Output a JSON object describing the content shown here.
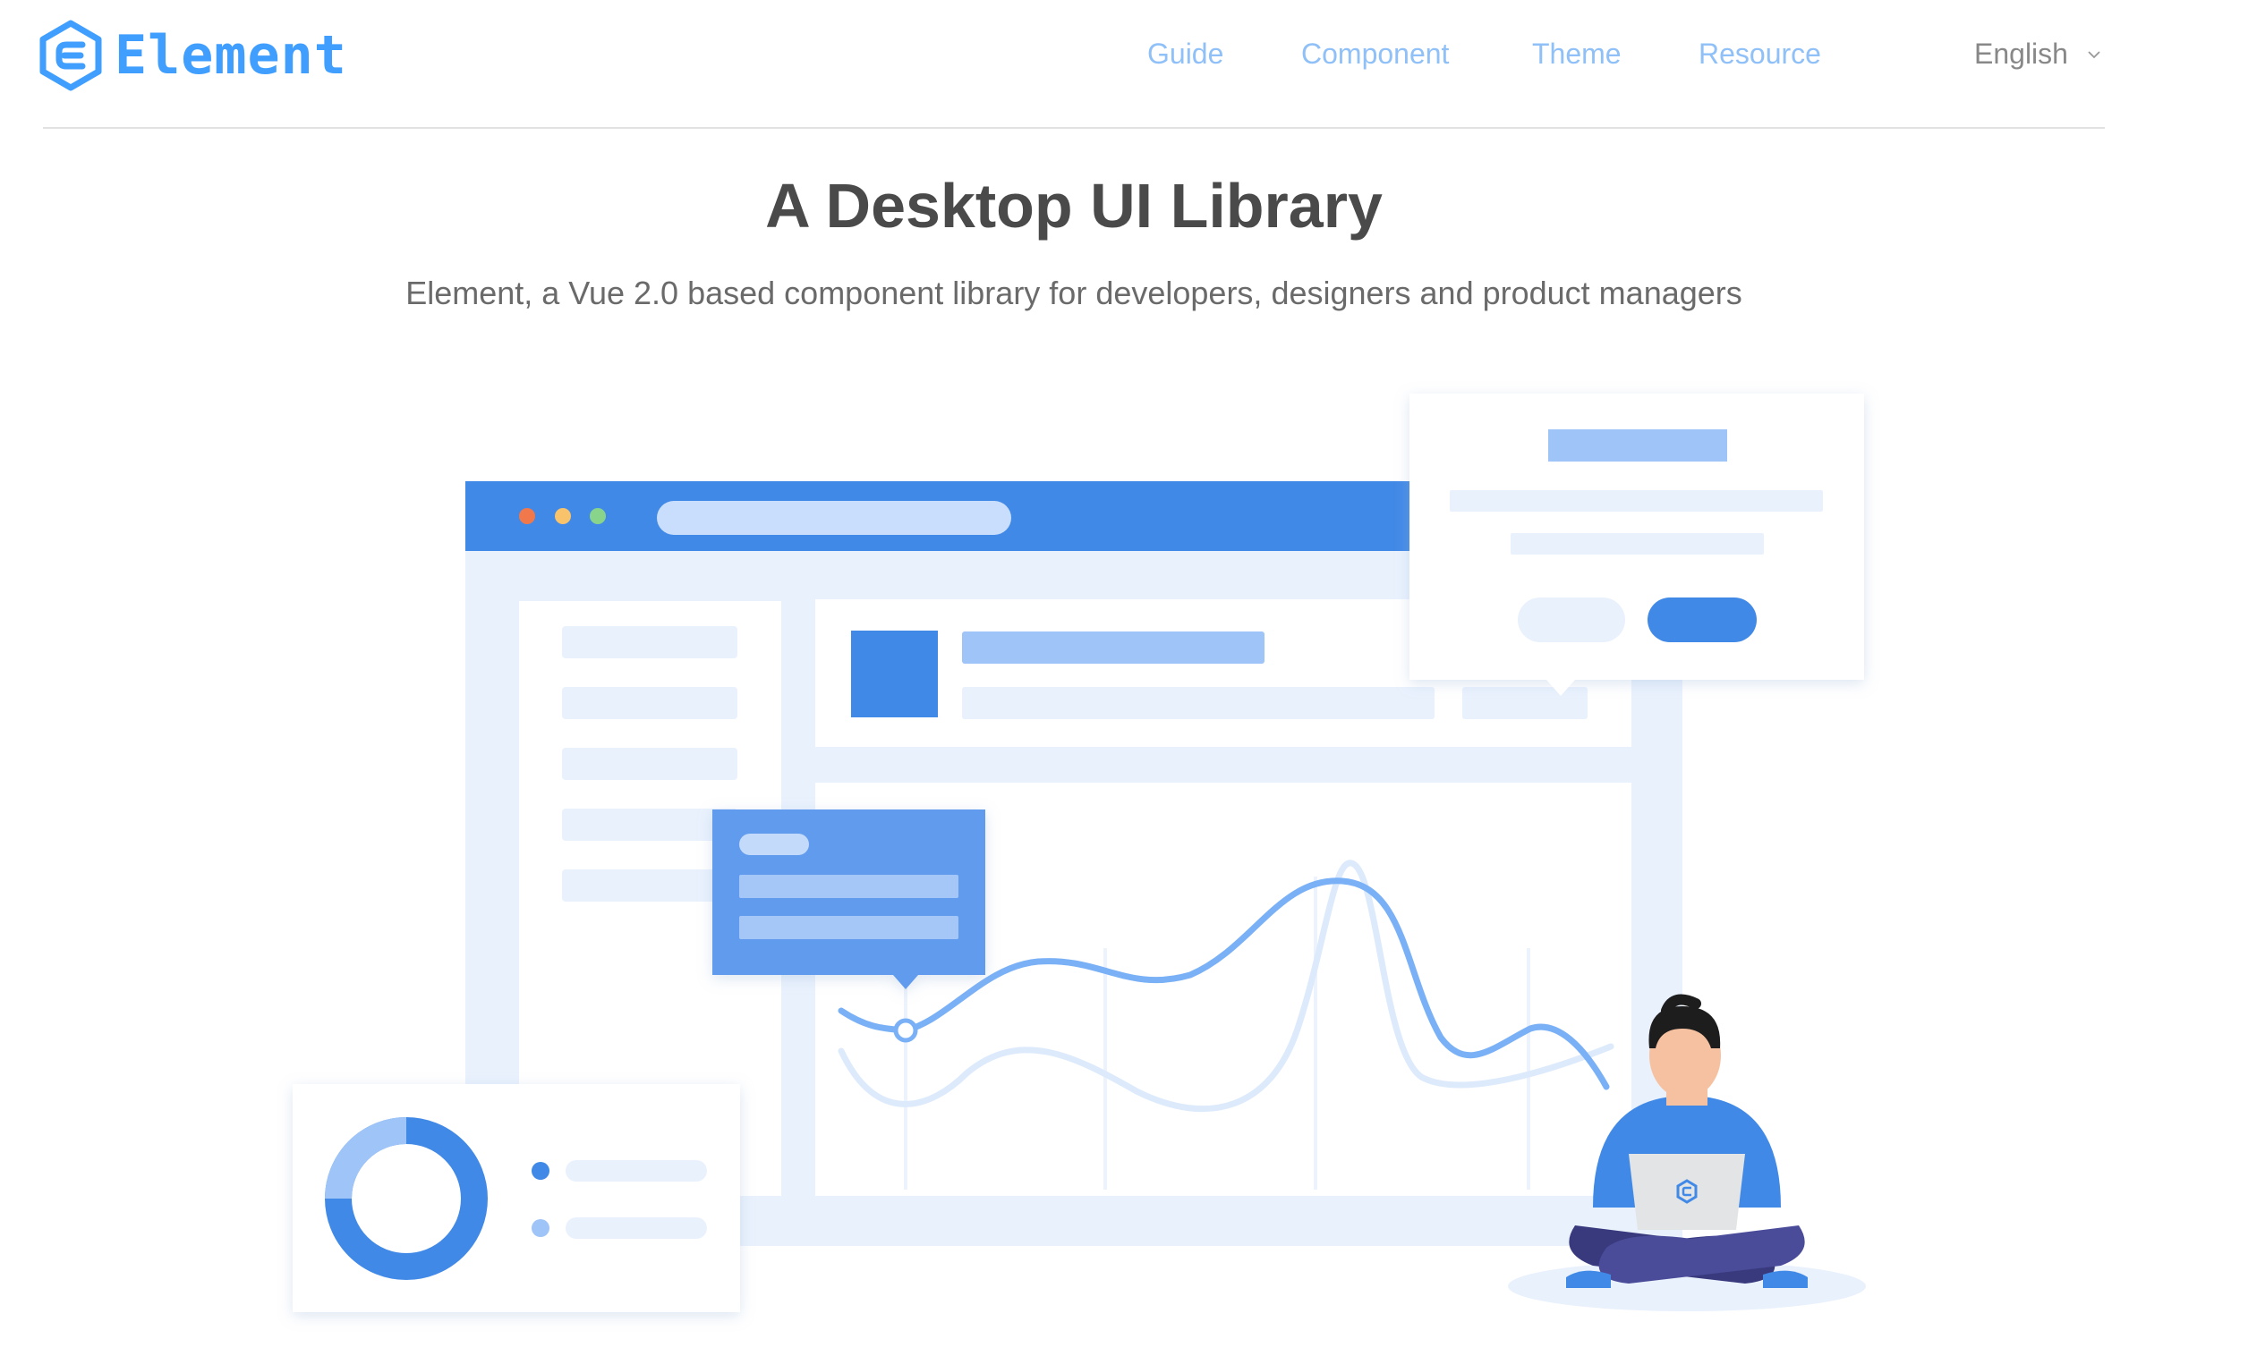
{
  "brand": {
    "name": "Element",
    "color": "#409eff"
  },
  "nav": {
    "items": [
      {
        "label": "Guide"
      },
      {
        "label": "Component"
      },
      {
        "label": "Theme"
      },
      {
        "label": "Resource"
      }
    ],
    "language": {
      "label": "English",
      "icon": "chevron-down-icon"
    }
  },
  "hero": {
    "title": "A Desktop UI Library",
    "subtitle": "Element, a Vue 2.0 based component library for developers, designers and product managers"
  },
  "illustration": {
    "icons": [
      "window-dots",
      "donut-chart",
      "line-chart",
      "person-with-laptop",
      "dialog-card",
      "tooltip-card"
    ],
    "colors": {
      "primary": "#4189e6",
      "light": "#e9f1fd",
      "accent_light": "#9fc4f7",
      "red_dot": "#f0784b",
      "yellow_dot": "#f8c36b",
      "green_dot": "#89d48b"
    }
  }
}
